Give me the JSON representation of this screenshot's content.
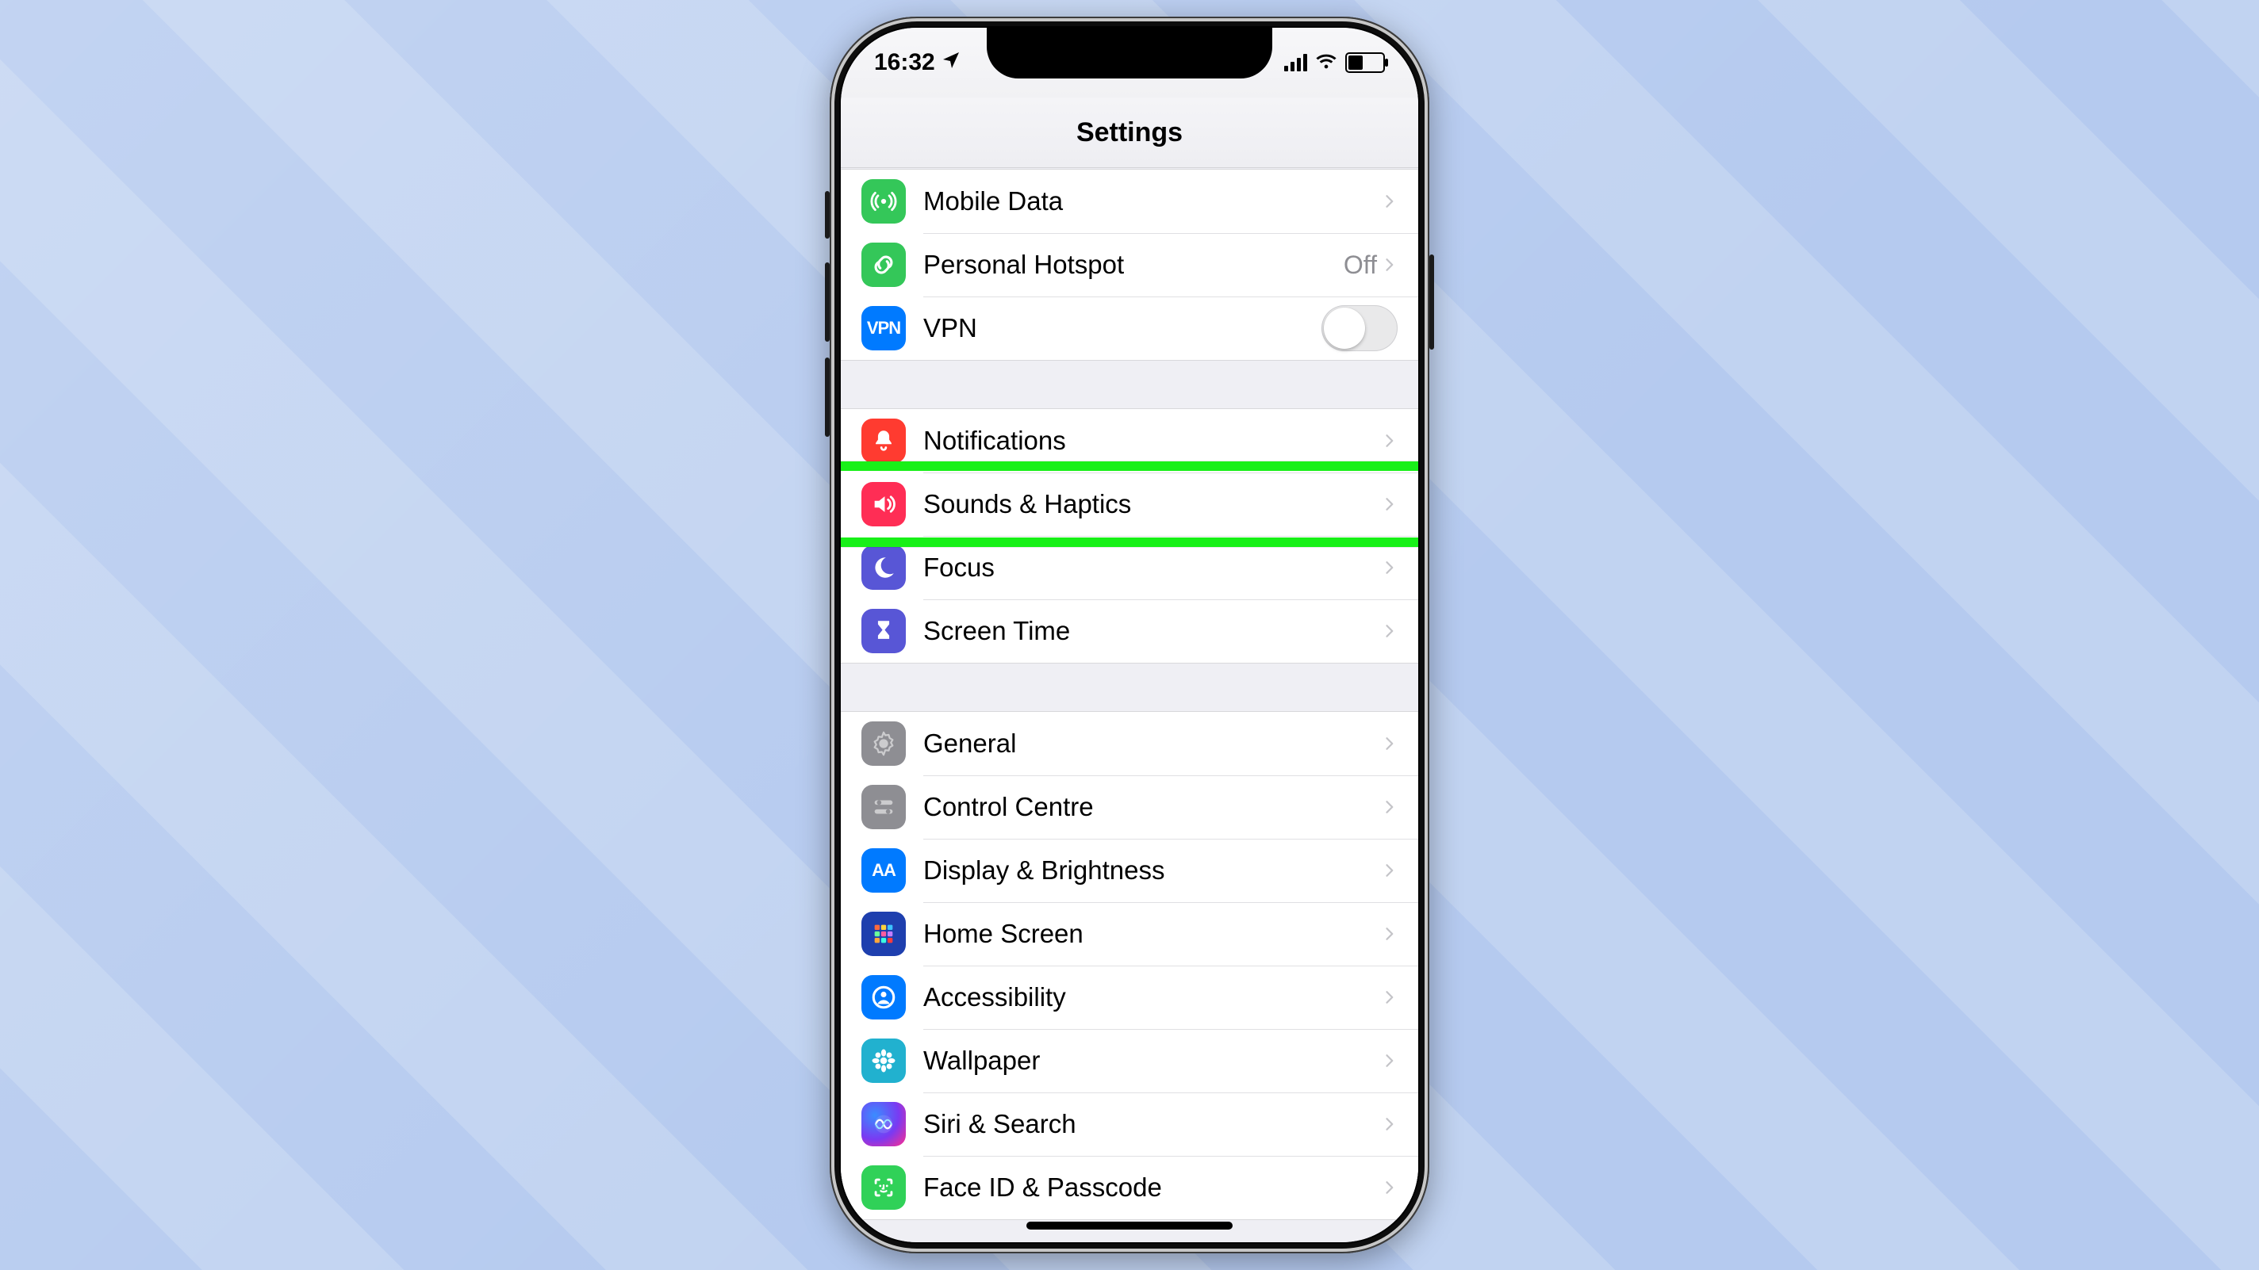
{
  "status": {
    "time": "16:32"
  },
  "nav": {
    "title": "Settings"
  },
  "highlighted_row_name": "sounds-haptics",
  "groups": [
    {
      "rows": [
        {
          "name": "mobile-data",
          "label": "Mobile Data",
          "icon": "antenna-icon",
          "icon_bg": "bg-green",
          "accessory": "chevron"
        },
        {
          "name": "personal-hotspot",
          "label": "Personal Hotspot",
          "icon": "link-icon",
          "icon_bg": "bg-green",
          "accessory": "chevron",
          "value": "Off"
        },
        {
          "name": "vpn",
          "label": "VPN",
          "icon": "vpn-icon",
          "icon_bg": "bg-blue",
          "accessory": "toggle",
          "toggled": false,
          "icon_text": "VPN"
        }
      ]
    },
    {
      "rows": [
        {
          "name": "notifications",
          "label": "Notifications",
          "icon": "bell-icon",
          "icon_bg": "bg-red",
          "accessory": "chevron"
        },
        {
          "name": "sounds-haptics",
          "label": "Sounds & Haptics",
          "icon": "speaker-icon",
          "icon_bg": "bg-pink",
          "accessory": "chevron"
        },
        {
          "name": "focus",
          "label": "Focus",
          "icon": "moon-icon",
          "icon_bg": "bg-indigo",
          "accessory": "chevron"
        },
        {
          "name": "screen-time",
          "label": "Screen Time",
          "icon": "hourglass-icon",
          "icon_bg": "bg-indigo",
          "accessory": "chevron"
        }
      ]
    },
    {
      "rows": [
        {
          "name": "general",
          "label": "General",
          "icon": "gear-icon",
          "icon_bg": "bg-gray",
          "accessory": "chevron"
        },
        {
          "name": "control-centre",
          "label": "Control Centre",
          "icon": "switches-icon",
          "icon_bg": "bg-gray",
          "accessory": "chevron"
        },
        {
          "name": "display-brightness",
          "label": "Display & Brightness",
          "icon": "text-size-icon",
          "icon_bg": "bg-blue",
          "accessory": "chevron",
          "icon_text": "AA"
        },
        {
          "name": "home-screen",
          "label": "Home Screen",
          "icon": "app-grid-icon",
          "icon_bg": "bg-grid",
          "accessory": "chevron"
        },
        {
          "name": "accessibility",
          "label": "Accessibility",
          "icon": "person-circle-icon",
          "icon_bg": "bg-blue",
          "accessory": "chevron"
        },
        {
          "name": "wallpaper",
          "label": "Wallpaper",
          "icon": "flower-icon",
          "icon_bg": "bg-cyan",
          "accessory": "chevron"
        },
        {
          "name": "siri-search",
          "label": "Siri & Search",
          "icon": "siri-icon",
          "icon_bg": "bg-siri",
          "accessory": "chevron"
        },
        {
          "name": "face-id-passcode",
          "label": "Face ID & Passcode",
          "icon": "faceid-icon",
          "icon_bg": "bg-green2",
          "accessory": "chevron"
        }
      ]
    }
  ]
}
